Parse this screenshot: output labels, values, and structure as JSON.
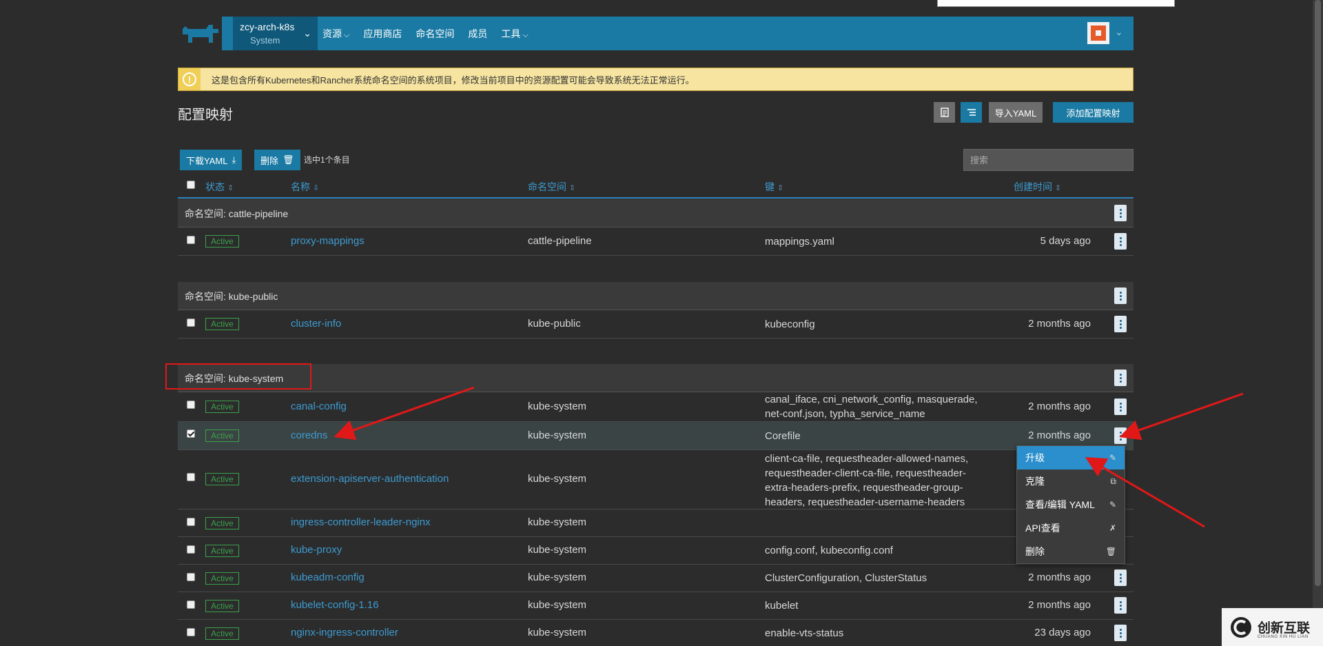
{
  "header": {
    "cluster_name": "zcy-arch-k8s",
    "project_name": "System",
    "nav": [
      {
        "label": "资源",
        "has_caret": true
      },
      {
        "label": "应用商店",
        "has_caret": false
      },
      {
        "label": "命名空间",
        "has_caret": false
      },
      {
        "label": "成员",
        "has_caret": false
      },
      {
        "label": "工具",
        "has_caret": true
      }
    ]
  },
  "banner": {
    "text": "这是包含所有Kubernetes和Rancher系统命名空间的系统项目，修改当前项目中的资源配置可能会导致系统无法正常运行。"
  },
  "page": {
    "title": "配置映射",
    "import_yaml": "导入YAML",
    "add_configmap": "添加配置映射"
  },
  "bulk": {
    "download_yaml": "下载YAML",
    "delete": "删除",
    "selected_count": "选中1个条目",
    "search_placeholder": "搜索"
  },
  "table": {
    "columns": {
      "state": "状态",
      "name": "名称",
      "namespace": "命名空间",
      "keys": "键",
      "created": "创建时间"
    },
    "groups": [
      {
        "label": "命名空间: cattle-pipeline",
        "rows": [
          {
            "state": "Active",
            "name": "proxy-mappings",
            "namespace": "cattle-pipeline",
            "keys": "mappings.yaml",
            "created": "5 days ago",
            "checked": false
          }
        ]
      },
      {
        "label": "命名空间: kube-public",
        "rows": [
          {
            "state": "Active",
            "name": "cluster-info",
            "namespace": "kube-public",
            "keys": "kubeconfig",
            "created": "2 months ago",
            "checked": false
          }
        ]
      },
      {
        "label": "命名空间: kube-system",
        "rows": [
          {
            "state": "Active",
            "name": "canal-config",
            "namespace": "kube-system",
            "keys": "canal_iface, cni_network_config, masquerade, net-conf.json, typha_service_name",
            "created": "2 months ago",
            "checked": false
          },
          {
            "state": "Active",
            "name": "coredns",
            "namespace": "kube-system",
            "keys": "Corefile",
            "created": "2 months ago",
            "checked": true
          },
          {
            "state": "Active",
            "name": "extension-apiserver-authentication",
            "namespace": "kube-system",
            "keys": "client-ca-file, requestheader-allowed-names, requestheader-client-ca-file, requestheader-extra-headers-prefix, requestheader-group-headers, requestheader-username-headers",
            "created": "",
            "checked": false
          },
          {
            "state": "Active",
            "name": "ingress-controller-leader-nginx",
            "namespace": "kube-system",
            "keys": "",
            "created": "",
            "checked": false
          },
          {
            "state": "Active",
            "name": "kube-proxy",
            "namespace": "kube-system",
            "keys": "config.conf, kubeconfig.conf",
            "created": "",
            "checked": false
          },
          {
            "state": "Active",
            "name": "kubeadm-config",
            "namespace": "kube-system",
            "keys": "ClusterConfiguration, ClusterStatus",
            "created": "2 months ago",
            "checked": false
          },
          {
            "state": "Active",
            "name": "kubelet-config-1.16",
            "namespace": "kube-system",
            "keys": "kubelet",
            "created": "2 months ago",
            "checked": false
          },
          {
            "state": "Active",
            "name": "nginx-ingress-controller",
            "namespace": "kube-system",
            "keys": "enable-vts-status",
            "created": "23 days ago",
            "checked": false
          }
        ]
      }
    ]
  },
  "menu": {
    "items": [
      {
        "label": "升级",
        "icon": "pencil-icon",
        "active": true
      },
      {
        "label": "克隆",
        "icon": "copy-icon",
        "active": false
      },
      {
        "label": "查看/编辑 YAML",
        "icon": "pencil-icon",
        "active": false
      },
      {
        "label": "API查看",
        "icon": "tools-icon",
        "active": false
      },
      {
        "label": "删除",
        "icon": "trash-icon",
        "active": false
      }
    ]
  },
  "watermark": {
    "text": "创新互联",
    "sub": "CHUANG XIN HU LIAN"
  },
  "colors": {
    "header": "#1a7aa3",
    "accent_link": "#3d9bd1",
    "active_badge": "#3ba24a",
    "annotation": "#e01818",
    "menu_active": "#2a8fcc"
  }
}
